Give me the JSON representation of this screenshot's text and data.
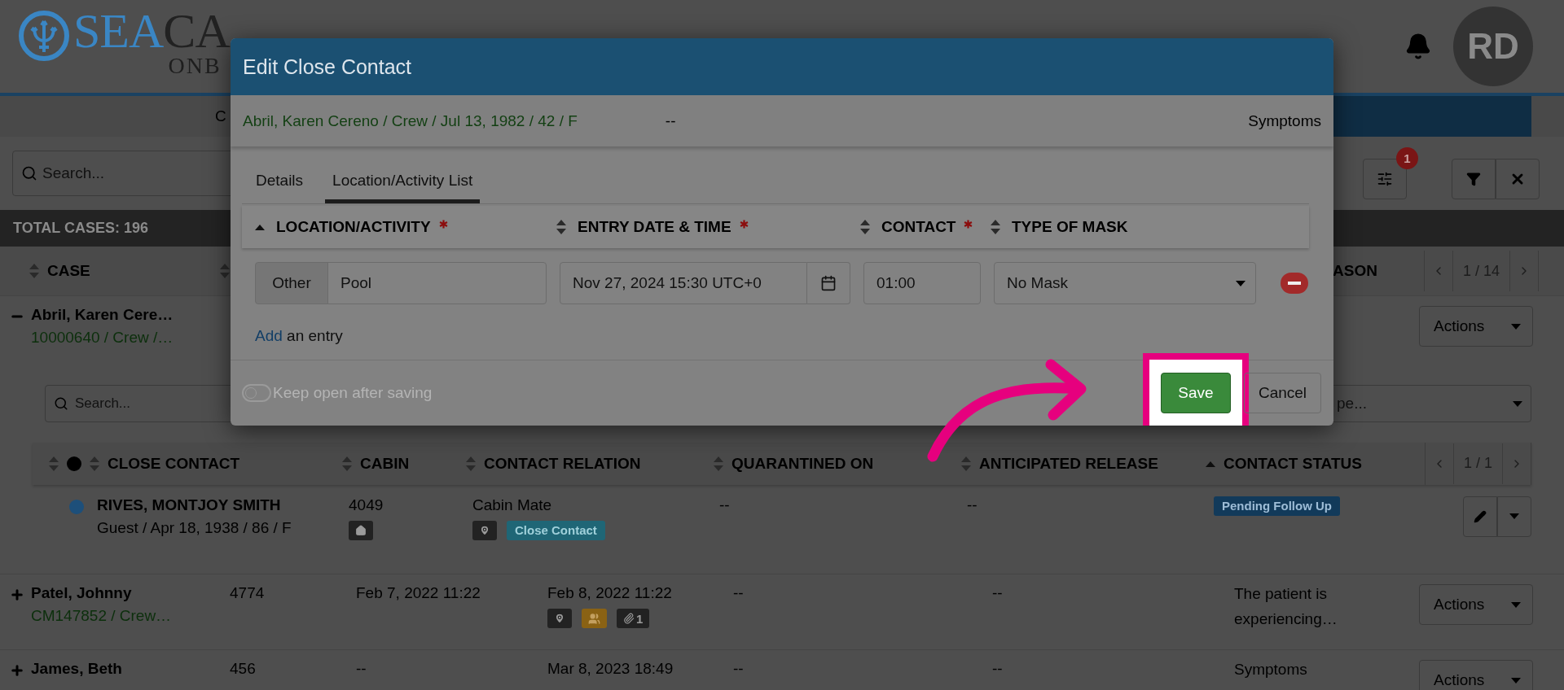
{
  "logo": {
    "primary": "SEA",
    "secondary": "CA",
    "tagline": "ONB"
  },
  "header": {
    "avatar": "RD"
  },
  "nav": {
    "item": "C"
  },
  "toolbar": {
    "search_placeholder": "Search...",
    "settings_badge": "1"
  },
  "summary": "TOTAL CASES: 196",
  "cases_table": {
    "columns": [
      {
        "label": "CASE",
        "sorted_ascending": false
      },
      {
        "sorted_ascending": false
      },
      {
        "label": "ASON"
      }
    ],
    "pager": "1 / 14",
    "rows": [
      {
        "expanded": true,
        "name": "Abril, Karen Cere…",
        "detail": "10000640 / Crew /…",
        "action": "Actions"
      },
      {
        "expanded": false,
        "name": "Patel, Johnny",
        "detail": "CM147852 / Crew…",
        "cells": [
          "4774",
          "Feb 7, 2022 11:22",
          "Feb 8, 2022 11:22",
          "--",
          "--",
          "The patient is experiencing…"
        ],
        "badges": [
          {
            "kind": "location"
          },
          {
            "kind": "people"
          },
          {
            "kind": "attachment",
            "text": "1"
          }
        ],
        "action": "Actions"
      },
      {
        "expanded": false,
        "name": "James, Beth",
        "cells": [
          "456",
          "--",
          "Mar 8, 2023 18:49",
          "--",
          "--",
          "Symptoms"
        ],
        "action": "Actions"
      }
    ]
  },
  "contacts": {
    "search_placeholder": "Search...",
    "type_filter": "pe...",
    "pager": "1 / 1",
    "status_column": {
      "sorted_ascending": false
    },
    "columns": [
      {
        "label": "CLOSE CONTACT",
        "sorted_ascending": false
      },
      {
        "label": "CABIN",
        "sorted_ascending": false
      },
      {
        "label": "CONTACT RELATION",
        "sorted_ascending": false
      },
      {
        "label": "QUARANTINED ON",
        "sorted_ascending": false
      },
      {
        "label": "ANTICIPATED RELEASE",
        "sorted_ascending": false
      },
      {
        "label": "CONTACT STATUS",
        "sorted_ascending": true
      }
    ],
    "rows": [
      {
        "color": "#1d4f7a",
        "name": "RIVES, MONTJOY SMITH",
        "detail": "Guest / Apr 18, 1938 / 86 / F",
        "cabin": "4049",
        "cabin_badges": [
          {
            "kind": "home"
          }
        ],
        "relation": "Cabin Mate",
        "relation_badges": [
          {
            "kind": "location"
          },
          {
            "kind": "tag",
            "text": "Close Contact"
          }
        ],
        "quarantined_on": "--",
        "anticipated_release": "--",
        "status": "Pending Follow Up"
      }
    ]
  },
  "modal": {
    "title": "Edit Close Contact",
    "subject": "Abril, Karen Cereno / Crew / Jul 13, 1982 / 42 / F",
    "subject_middle": "--",
    "subject_right": "Symptoms",
    "tabs": [
      {
        "label": "Details",
        "selected": false
      },
      {
        "label": "Location/Activity List",
        "selected": true
      }
    ],
    "columns": [
      {
        "label": "LOCATION/ACTIVITY",
        "sorted_ascending": true,
        "required": true
      },
      {
        "label": "ENTRY DATE & TIME",
        "sorted_ascending": false,
        "required": true
      },
      {
        "label": "CONTACT",
        "sorted_ascending": false,
        "required": true
      },
      {
        "label": "TYPE OF MASK",
        "sorted_ascending": false,
        "required": false
      }
    ],
    "entries": [
      {
        "type": "Other",
        "location": "Pool",
        "entry_time": "Nov 27, 2024 15:30 UTC+0",
        "contact": "01:00",
        "mask": "No Mask"
      }
    ],
    "add_link": "Add",
    "add_text": "an entry",
    "keep_open": {
      "label": "Keep open after saving",
      "on": false
    },
    "save": "Save",
    "cancel": "Cancel"
  }
}
